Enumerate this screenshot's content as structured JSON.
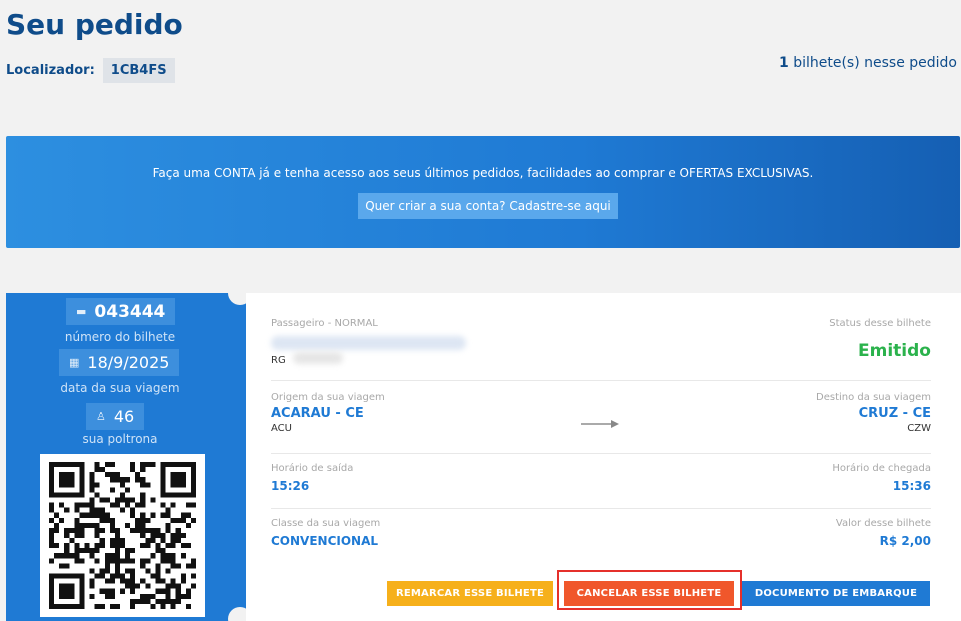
{
  "header": {
    "title": "Seu pedido",
    "locator_label": "Localizador:",
    "locator_code": "1CB4FS",
    "ticket_count": "1",
    "ticket_count_suffix": " bilhete(s) nesse pedido"
  },
  "banner": {
    "text": "Faça uma CONTA já e tenha acesso aos seus últimos pedidos, facilidades ao comprar e OFERTAS EXCLUSIVAS.",
    "button": "Quer criar a sua conta? Cadastre-se aqui"
  },
  "stub": {
    "ticket_number": "043444",
    "ticket_number_caption": "número do bilhete",
    "travel_date": "18/9/2025",
    "travel_date_caption": "data da sua viagem",
    "seat": "46",
    "seat_caption": "sua poltrona",
    "icons": {
      "ticket": "ticket-icon",
      "date": "calendar-icon",
      "seat": "seat-icon"
    }
  },
  "ticket": {
    "passenger_label": "Passageiro - NORMAL",
    "rg_label": "RG",
    "status_label": "Status desse bilhete",
    "status_value": "Emitido",
    "origin_label": "Origem da sua viagem",
    "origin_value": "ACARAU - CE",
    "origin_code": "ACU",
    "destination_label": "Destino da sua viagem",
    "destination_value": "CRUZ - CE",
    "destination_code": "CZW",
    "departure_label": "Horário de saída",
    "departure_value": "15:26",
    "arrival_label": "Horário de chegada",
    "arrival_value": "15:36",
    "class_label": "Classe da sua viagem",
    "class_value": "CONVENCIONAL",
    "price_label": "Valor desse bilhete",
    "price_value": "R$ 2,00"
  },
  "actions": {
    "reschedule": "REMARCAR ESSE BILHETE",
    "cancel": "CANCELAR ESSE BILHETE",
    "boarding_doc": "DOCUMENTO DE EMBARQUE"
  },
  "colors": {
    "brand_blue": "#1f7ad4",
    "title_blue": "#0f4c8a",
    "status_green": "#2bb24c",
    "reschedule_orange": "#f6b01b",
    "cancel_red": "#f0572b",
    "highlight_red": "#e5302b"
  }
}
